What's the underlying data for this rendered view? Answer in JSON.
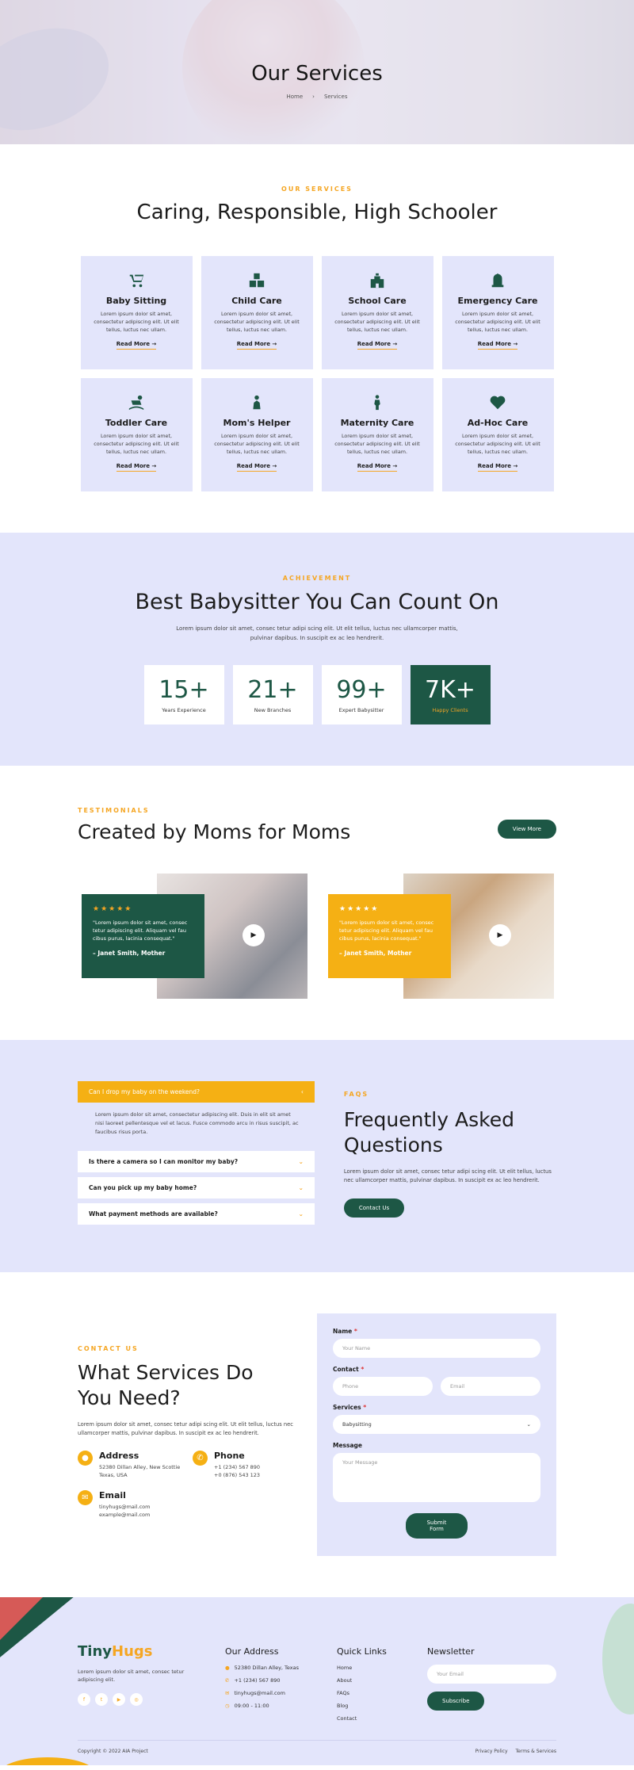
{
  "hero": {
    "title": "Our Services",
    "crumb_home": "Home",
    "crumb_sep": "›",
    "crumb_current": "Services"
  },
  "services": {
    "eyebrow": "OUR SERVICES",
    "title": "Caring, Responsible, High Schooler",
    "read_more": "Read More  →",
    "items": [
      {
        "title": "Baby Sitting",
        "icon": "stroller-icon",
        "text": "Lorem ipsum dolor sit amet, consectetur adipiscing elit. Ut elit tellus, luctus nec ullam."
      },
      {
        "title": "Child Care",
        "icon": "blocks-icon",
        "text": "Lorem ipsum dolor sit amet, consectetur adipiscing elit. Ut elit tellus, luctus nec ullam."
      },
      {
        "title": "School Care",
        "icon": "school-icon",
        "text": "Lorem ipsum dolor sit amet, consectetur adipiscing elit. Ut elit tellus, luctus nec ullam."
      },
      {
        "title": "Emergency Care",
        "icon": "emergency-icon",
        "text": "Lorem ipsum dolor sit amet, consectetur adipiscing elit. Ut elit tellus, luctus nec ullam."
      },
      {
        "title": "Toddler Care",
        "icon": "rocking-horse-icon",
        "text": "Lorem ipsum dolor sit amet, consectetur adipiscing elit. Ut elit tellus, luctus nec ullam."
      },
      {
        "title": "Mom's Helper",
        "icon": "mother-icon",
        "text": "Lorem ipsum dolor sit amet, consectetur adipiscing elit. Ut elit tellus, luctus nec ullam."
      },
      {
        "title": "Maternity Care",
        "icon": "pregnant-icon",
        "text": "Lorem ipsum dolor sit amet, consectetur adipiscing elit. Ut elit tellus, luctus nec ullam."
      },
      {
        "title": "Ad-Hoc Care",
        "icon": "heartbeat-icon",
        "text": "Lorem ipsum dolor sit amet, consectetur adipiscing elit. Ut elit tellus, luctus nec ullam."
      }
    ]
  },
  "achievement": {
    "eyebrow": "ACHIEVEMENT",
    "title": "Best Babysitter You Can Count On",
    "sub": "Lorem ipsum dolor sit amet, consec tetur adipi scing elit. Ut elit tellus, luctus nec ullamcorper mattis, pulvinar dapibus. In suscipit ex ac leo hendrerit.",
    "stats": [
      {
        "n": "15+",
        "l": "Years Experience"
      },
      {
        "n": "21+",
        "l": "New Branches"
      },
      {
        "n": "99+",
        "l": "Expert Babysitter"
      },
      {
        "n": "7K+",
        "l": "Happy Clients"
      }
    ]
  },
  "testimonials": {
    "eyebrow": "TESTIMONIALS",
    "title": "Created by Moms for Moms",
    "view_more": "View More",
    "stars": "★★★★★",
    "items": [
      {
        "quote": "\"Lorem ipsum dolor sit amet, consec tetur adipiscing elit. Aliquam vel fau cibus purus, lacinia consequat.\"",
        "who": "– Janet Smith, Mother",
        "bg": "#1d5745"
      },
      {
        "quote": "\"Lorem ipsum dolor sit amet, consec tetur adipiscing elit. Aliquam vel fau cibus purus, lacinia consequat.\"",
        "who": "– Janet Smith, Mother",
        "bg": "#f5b014"
      }
    ]
  },
  "faq": {
    "eyebrow": "FAQS",
    "title": "Frequently Asked Questions",
    "desc": "Lorem ipsum dolor sit amet, consec tetur adipi scing elit. Ut elit tellus, luctus nec ullamcorper mattis, pulvinar dapibus. In suscipit ex ac leo hendrerit.",
    "button": "Contact Us",
    "open_q": "Can I drop my baby on the weekend?",
    "open_a": "Lorem ipsum dolor sit amet, consectetur adipiscing elit. Duis in elit sit amet nisi laoreet pellentesque vel et lacus. Fusce commodo arcu in risus suscipit, ac faucibus risus porta.",
    "items": [
      "Is there a camera so I can monitor my baby?",
      "Can you pick up my baby home?",
      "What payment methods are available?"
    ]
  },
  "contact": {
    "eyebrow": "CONTACT US",
    "title": "What Services Do You Need?",
    "desc": "Lorem ipsum dolor sit amet, consec tetur adipi scing elit. Ut elit tellus, luctus nec ullamcorper mattis, pulvinar dapibus. In suscipit ex ac leo hendrerit.",
    "address_h": "Address",
    "address": "52380 Dillan Alley, New Scottie Texas, USA",
    "phone_h": "Phone",
    "phone1": "+1 (234) 567 890",
    "phone2": "+0 (876) 543 123",
    "email_h": "Email",
    "email1": "tinyhugs@mail.com",
    "email2": "example@mail.com"
  },
  "form": {
    "name_label": "Name",
    "req": "*",
    "name_ph": "Your Name",
    "contact_label": "Contact",
    "phone_ph": "Phone",
    "email_ph": "Email",
    "services_label": "Services",
    "services_value": "Babysitting",
    "message_label": "Message",
    "message_ph": "Your Message",
    "submit": "Submit Form"
  },
  "footer": {
    "logo_a": "Tiny",
    "logo_b": "Hugs",
    "desc": "Lorem ipsum dolor sit amet, consec tetur adipiscing elit.",
    "addr_h": "Our Address",
    "addr": "52380 Dillan Alley, Texas",
    "phone": "+1 (234) 567 890",
    "email": "tinyhugs@mail.com",
    "hours": "09:00 - 11:00",
    "links_h": "Quick Links",
    "links": [
      "Home",
      "About",
      "FAQs",
      "Blog",
      "Contact"
    ],
    "news_h": "Newsletter",
    "news_ph": "Your Email",
    "subscribe": "Subscribe",
    "copyright": "Copyright © 2022 AIA Project",
    "privacy": "Privacy Policy",
    "terms": "Terms & Services"
  }
}
